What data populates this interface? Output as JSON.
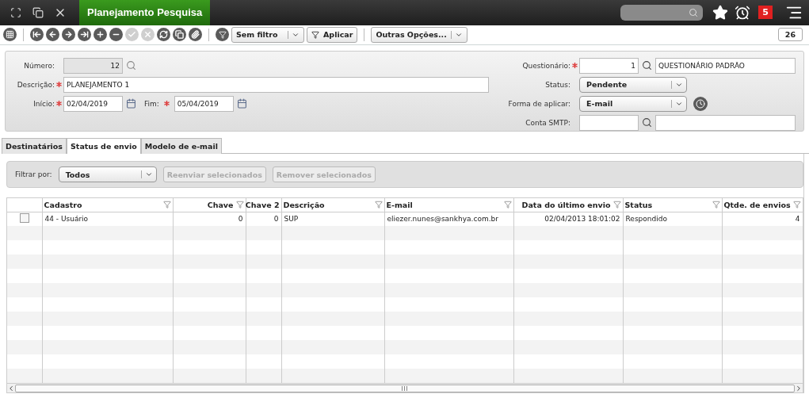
{
  "top_bar": {
    "tab": {
      "title": "Planejamento Pesquisa",
      "selected": true
    },
    "notifications": "5"
  },
  "toolbar": {
    "buttons": [
      {
        "kind": "first",
        "disabled": false
      },
      {
        "kind": "prev",
        "disabled": false
      },
      {
        "kind": "next",
        "disabled": false
      },
      {
        "kind": "last",
        "disabled": false
      },
      {
        "kind": "add",
        "disabled": false
      },
      {
        "kind": "remove",
        "disabled": false
      },
      {
        "kind": "save",
        "disabled": true
      },
      {
        "kind": "cancel",
        "disabled": true
      },
      {
        "kind": "refresh",
        "disabled": false
      },
      {
        "kind": "copy",
        "disabled": false
      },
      {
        "kind": "attach",
        "disabled": false
      }
    ],
    "filter": "Sem filtro",
    "apply": "Aplicar",
    "options": "Outras Opções...",
    "record_count": "26"
  },
  "form": {
    "numero": {
      "label": "Número:",
      "required": false,
      "value": "12"
    },
    "descricao": {
      "label": "Descrição:",
      "required": true,
      "value": "PLANEJAMENTO 1"
    },
    "inicio": {
      "label": "Início:",
      "required": true,
      "value": "02/04/2019"
    },
    "fim": {
      "label": "Fim:",
      "required": true,
      "value": "05/04/2019"
    },
    "questionario": {
      "label": "Questionário:",
      "required": true,
      "code": "1",
      "name": "QUESTIONÁRIO PADRÃO"
    },
    "status": {
      "label": "Status:",
      "required": false,
      "value": "Pendente"
    },
    "forma": {
      "label": "Forma de aplicar:",
      "required": false,
      "value": "E-mail"
    },
    "smtp": {
      "label": "Conta SMTP:",
      "required": false
    }
  },
  "tabs": [
    {
      "label": "Destinatários",
      "selected": false
    },
    {
      "label": "Status de envio",
      "selected": true
    },
    {
      "label": "Modelo de e-mail",
      "selected": false
    }
  ],
  "filter_bar": {
    "label": "Filtrar por:",
    "value": "Todos",
    "buttons": [
      {
        "label": "Reenviar selecionados",
        "disabled": true
      },
      {
        "label": "Remover selecionados",
        "disabled": true
      }
    ]
  },
  "table": {
    "columns": [
      {
        "label": "Cadastro",
        "kind": "text",
        "filter": true
      },
      {
        "label": "Chave",
        "kind": "number",
        "filter": true
      },
      {
        "label": "Chave 2",
        "kind": "number",
        "filter": false
      },
      {
        "label": "Descrição",
        "kind": "text",
        "filter": true
      },
      {
        "label": "E-mail",
        "kind": "text",
        "filter": true
      },
      {
        "label": "Data do último envio",
        "kind": "number",
        "filter": true
      },
      {
        "label": "Status",
        "kind": "text",
        "filter": true
      },
      {
        "label": "Qtde. de envios",
        "kind": "number",
        "filter": true
      }
    ],
    "rows": [
      {
        "checked": false,
        "cells": [
          "44 - Usuário",
          "0",
          "0",
          "SUP",
          "eliezer.nunes@sankhya.com.br",
          "02/04/2013 18:01:02",
          "Respondido",
          "4"
        ]
      }
    ]
  }
}
